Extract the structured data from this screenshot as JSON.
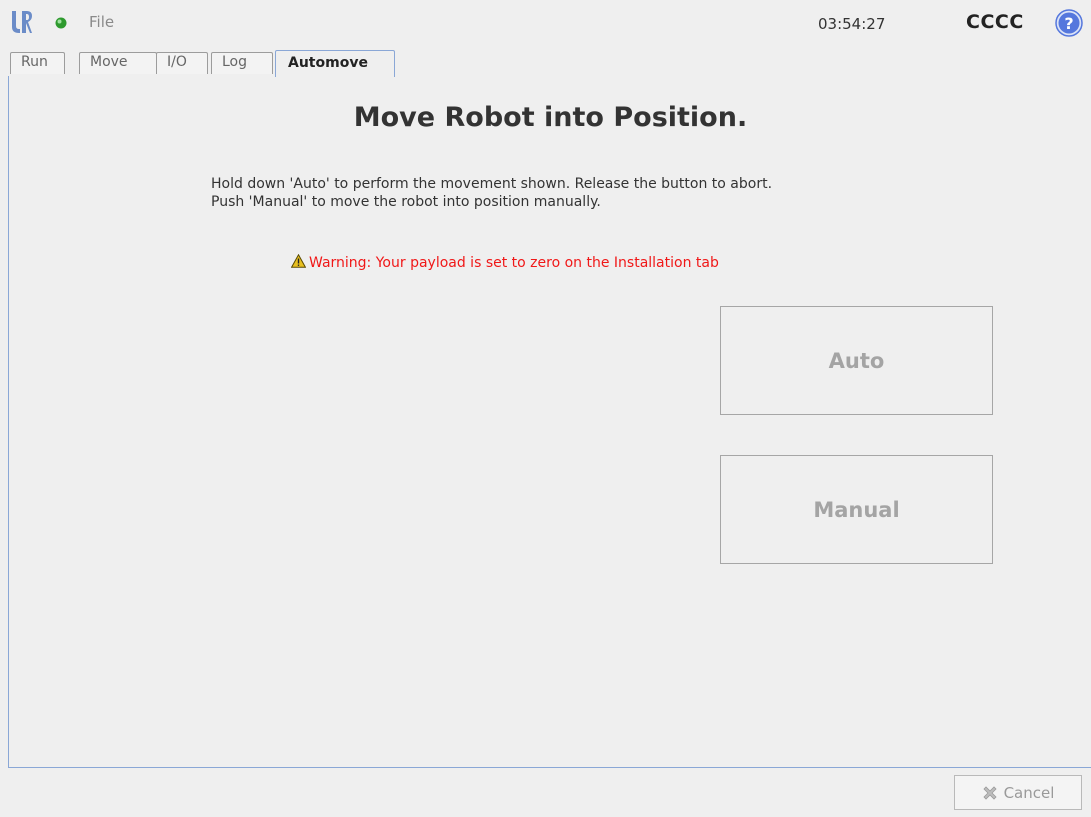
{
  "header": {
    "file_menu": "File",
    "clock": "03:54:27",
    "robot_name": "CCCC"
  },
  "tabs": [
    {
      "label": "Run",
      "active": false
    },
    {
      "label": "Move",
      "active": false
    },
    {
      "label": "I/O",
      "active": false
    },
    {
      "label": "Log",
      "active": false
    },
    {
      "label": "Automove",
      "active": true
    }
  ],
  "main": {
    "title": "Move Robot into Position.",
    "instructions": [
      "Hold down 'Auto' to perform the movement shown. Release the button to abort.",
      "Push 'Manual' to move the robot into position manually."
    ],
    "warning": "Warning: Your payload is set to zero on the Installation tab",
    "auto_label": "Auto",
    "manual_label": "Manual"
  },
  "footer": {
    "cancel_label": "Cancel"
  },
  "icons": {
    "logo": "universal-robots-logo",
    "status": "status-dot-icon",
    "help": "help-icon",
    "warning": "warning-icon",
    "cancel": "cancel-x-icon"
  },
  "colors": {
    "accent_blue": "#8aa7d6",
    "status_green": "#2e9a2e",
    "warning_red": "#f01818",
    "help_blue": "#5577dd"
  }
}
